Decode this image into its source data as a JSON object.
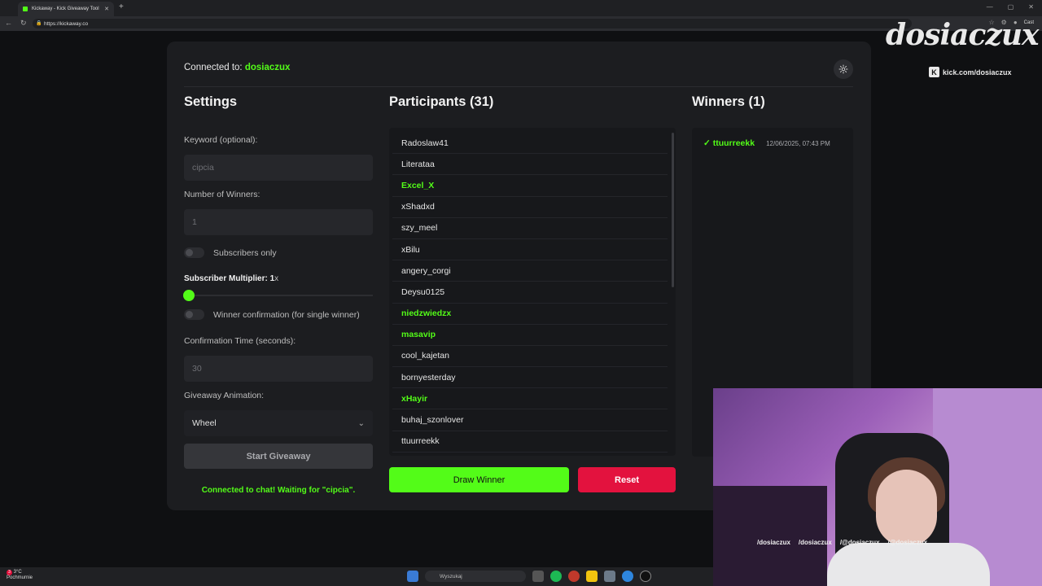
{
  "browser": {
    "tab_title": "Kickaway - Kick Giveaway Tool",
    "url": "https://kickaway.co",
    "cast_label": "Cast"
  },
  "app": {
    "connected_prefix": "Connected to: ",
    "connected_user": "dosiaczux",
    "settings": {
      "title": "Settings",
      "keyword_label": "Keyword (optional):",
      "keyword_value": "cipcia",
      "winners_label": "Number of Winners:",
      "winners_value": "1",
      "subscribers_only_label": "Subscribers only",
      "multiplier_label": "Subscriber Multiplier: 1",
      "multiplier_suffix": "x",
      "multiplier_value": 1,
      "winner_confirmation_label": "Winner confirmation (for single winner)",
      "confirmation_time_label": "Confirmation Time (seconds):",
      "confirmation_time_value": "30",
      "animation_label": "Giveaway Animation:",
      "animation_value": "Wheel",
      "start_button": "Start Giveaway",
      "status_text": "Connected to chat! Waiting for \"cipcia\"."
    },
    "participants": {
      "title": "Participants (31)",
      "items": [
        {
          "name": "Radoslaw41",
          "highlight": false
        },
        {
          "name": "Literataa",
          "highlight": false
        },
        {
          "name": "Excel_X",
          "highlight": true
        },
        {
          "name": "xShadxd",
          "highlight": false
        },
        {
          "name": "szy_meel",
          "highlight": false
        },
        {
          "name": "xBilu",
          "highlight": false
        },
        {
          "name": "angery_corgi",
          "highlight": false
        },
        {
          "name": "Deysu0125",
          "highlight": false
        },
        {
          "name": "niedzwiedzx",
          "highlight": true
        },
        {
          "name": "masavip",
          "highlight": true
        },
        {
          "name": "cool_kajetan",
          "highlight": false
        },
        {
          "name": "bornyesterday",
          "highlight": false
        },
        {
          "name": "xHayir",
          "highlight": true
        },
        {
          "name": "buhaj_szonlover",
          "highlight": false
        },
        {
          "name": "ttuurreekk",
          "highlight": false
        }
      ],
      "draw_button": "Draw Winner",
      "reset_button": "Reset"
    },
    "winners": {
      "title": "Winners (1)",
      "items": [
        {
          "name": "✓ ttuurreekk",
          "date": "12/06/2025, 07:43 PM"
        }
      ]
    }
  },
  "overlay": {
    "logo_text": "dosiaczux",
    "kick_link": "kick.com/dosiaczux",
    "socials": [
      "/dosiaczux",
      "/dosiaczux",
      "/@dosiaczux",
      "/@dosiaczux"
    ]
  },
  "taskbar": {
    "temperature": "3°C",
    "weather": "Pochmurnie",
    "search_placeholder": "Wyszukaj"
  },
  "colors": {
    "accent": "#53fc18",
    "danger": "#e3123e",
    "panel": "#1c1d20"
  }
}
